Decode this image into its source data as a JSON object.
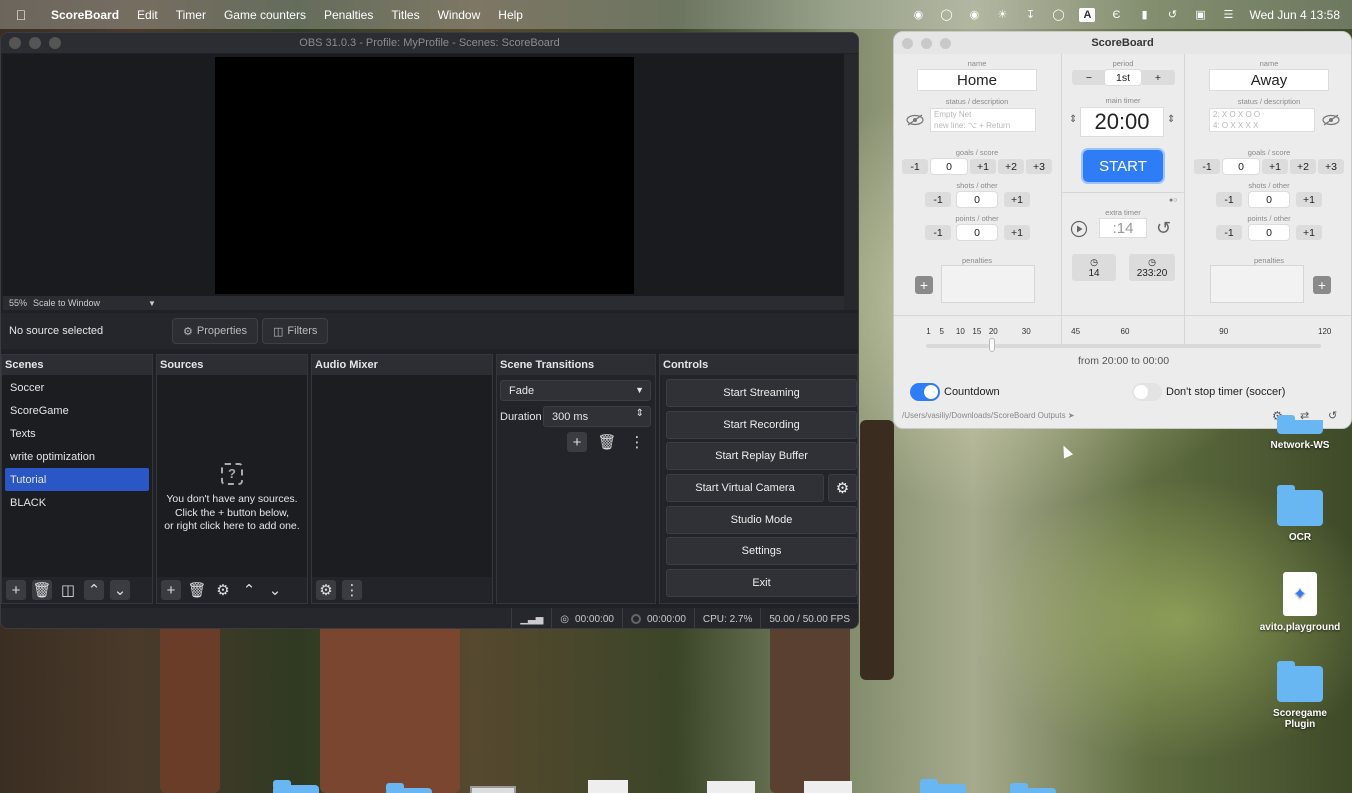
{
  "menubar": {
    "app": "ScoreBoard",
    "items": [
      "Edit",
      "Timer",
      "Game counters",
      "Penalties",
      "Titles",
      "Window",
      "Help"
    ],
    "input_badge": "A",
    "clock": "Wed Jun 4  13:58"
  },
  "obs": {
    "title": "OBS 31.0.3 - Profile: MyProfile - Scenes: ScoreBoard",
    "zoom": "55%",
    "scale_mode": "Scale to Window",
    "no_source": "No source selected",
    "properties_label": "Properties",
    "filters_label": "Filters",
    "scenes": {
      "title": "Scenes",
      "items": [
        "Soccer",
        "ScoreGame",
        "Texts",
        "write optimization",
        "Tutorial",
        "BLACK"
      ],
      "selected": "Tutorial"
    },
    "sources": {
      "title": "Sources",
      "empty_line1": "You don't have any sources.",
      "empty_line2": "Click the + button below,",
      "empty_line3": "or right click here to add one."
    },
    "audio_mixer": {
      "title": "Audio Mixer"
    },
    "transitions": {
      "title": "Scene Transitions",
      "selected": "Fade",
      "duration_label": "Duration",
      "duration_value": "300 ms"
    },
    "controls": {
      "title": "Controls",
      "start_streaming": "Start Streaming",
      "start_recording": "Start Recording",
      "start_replay": "Start Replay Buffer",
      "start_virtual_cam": "Start Virtual Camera",
      "studio_mode": "Studio Mode",
      "settings": "Settings",
      "exit": "Exit"
    },
    "status": {
      "stream_time": "00:00:00",
      "rec_time": "00:00:00",
      "cpu": "CPU: 2.7%",
      "fps": "50.00 / 50.00 FPS"
    }
  },
  "scoreboard": {
    "title": "ScoreBoard",
    "home": {
      "name_caption": "name",
      "name": "Home",
      "status_caption": "status / description",
      "status_line1": "Empty Net",
      "status_line2": "new line: ⌥ + Return",
      "goals_caption": "goals / score",
      "goals": "0",
      "shots_caption": "shots / other",
      "shots": "0",
      "points_caption": "points / other",
      "points": "0",
      "penalties_caption": "penalties"
    },
    "away": {
      "name_caption": "name",
      "name": "Away",
      "status_caption": "status / description",
      "status_line1": "2: X O X O O",
      "status_line2": "4: O X X X X",
      "goals_caption": "goals / score",
      "goals": "0",
      "shots_caption": "shots / other",
      "shots": "0",
      "points_caption": "points / other",
      "points": "0",
      "penalties_caption": "penalties"
    },
    "period_caption": "period",
    "period": "1st",
    "main_timer_caption": "main timer",
    "main_timer": "20:00",
    "start_label": "START",
    "extra_timer_caption": "extra timer",
    "extra_timer": ":14",
    "history_left": "14",
    "history_right": "233:20",
    "btn_minus1": "-1",
    "btn_plus1": "+1",
    "btn_plus2": "+2",
    "btn_plus3": "+3",
    "btn_minus": "−",
    "btn_plus": "+",
    "ticks": [
      "1",
      "5",
      "10",
      "15",
      "20",
      "30",
      "45",
      "60",
      "90",
      "120"
    ],
    "slider_value_minutes": 20,
    "range_text": "from 20:00 to 00:00",
    "countdown_label": "Countdown",
    "countdown_on": true,
    "dont_stop_label": "Don't stop timer (soccer)",
    "dont_stop_on": false,
    "output_path": "/Users/vasiliy/Downloads/ScoreBoard Outputs"
  },
  "desktop": {
    "icons": [
      "Network-WS",
      "OCR",
      "avito.playground",
      "Scoregame Plugin"
    ]
  },
  "colors": {
    "obs_bg": "#1f2126",
    "selection": "#2a56c6",
    "accent_blue": "#2e7cf6"
  }
}
